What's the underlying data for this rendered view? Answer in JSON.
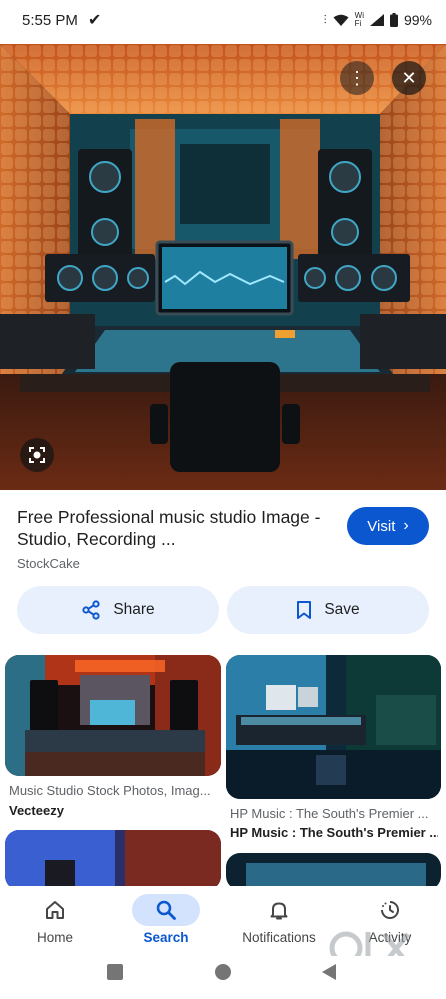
{
  "status": {
    "time": "5:55 PM",
    "battery": "99%"
  },
  "hero": {
    "alt": ""
  },
  "result": {
    "title": "Free Professional music studio Image - Studio, Recording ...",
    "source": "StockCake",
    "visit_label": "Visit"
  },
  "actions": {
    "share_label": "Share",
    "save_label": "Save"
  },
  "related": [
    {
      "caption": "Music Studio Stock Photos, Imag...",
      "source": "Vecteezy"
    },
    {
      "caption": "HP Music : The South's Premier ...",
      "source": "HP Music : The South's Premier ..."
    }
  ],
  "nav": {
    "home": "Home",
    "search": "Search",
    "notifications": "Notifications",
    "activity": "Activity"
  },
  "colors": {
    "accent": "#0b57d0",
    "pill_bg": "#e8f0fe",
    "active_bg": "#d3e3fd"
  }
}
